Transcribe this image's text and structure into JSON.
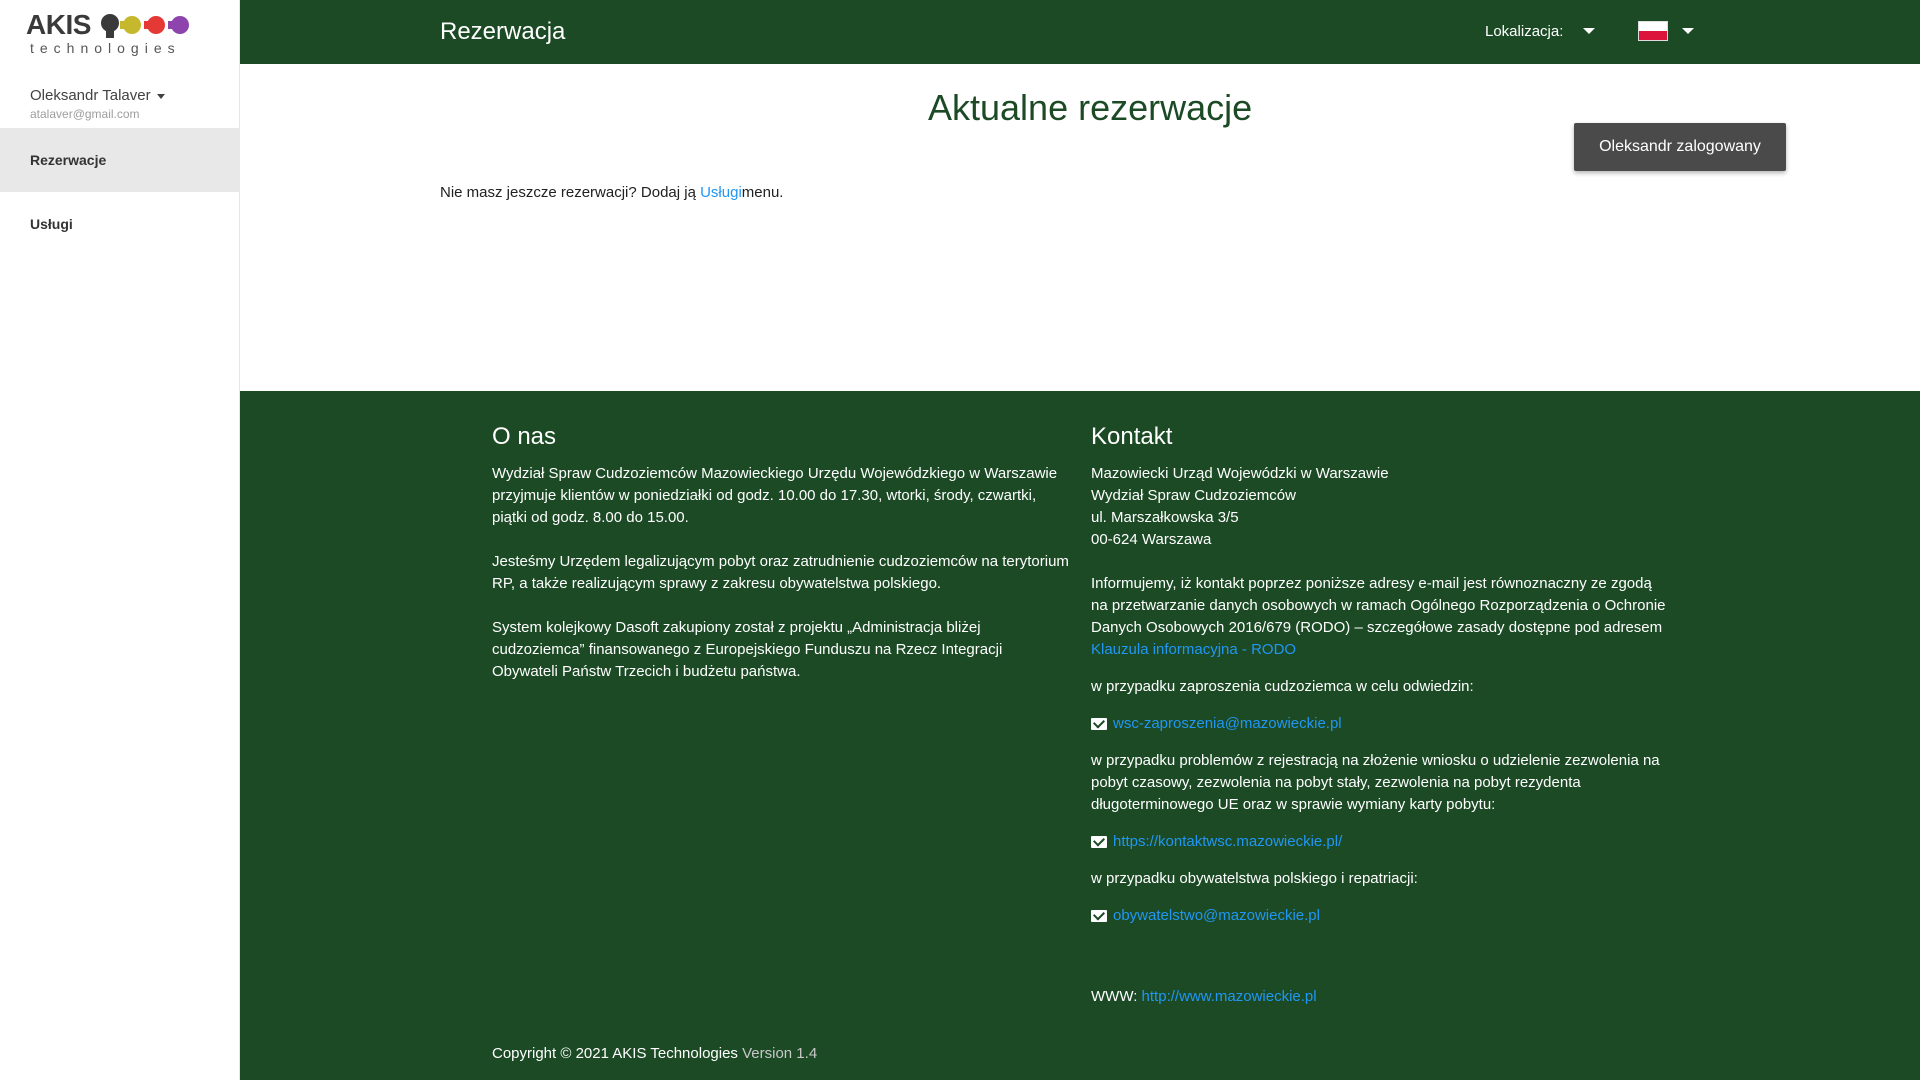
{
  "logo": {
    "word": "AKIS",
    "subtitle": "technologies",
    "colors": [
      "#e53935",
      "#fbc02d",
      "#8e24aa",
      "#6b8e23"
    ]
  },
  "user": {
    "name": "Oleksandr Talaver",
    "email": "atalaver@gmail.com"
  },
  "sidebar": {
    "items": [
      {
        "label": "Rezerwacje",
        "active": true
      },
      {
        "label": "Usługi",
        "active": false
      }
    ]
  },
  "topbar": {
    "title": "Rezerwacja",
    "location_label": "Lokalizacja:",
    "language_flag": "pl-flag-icon",
    "bg_color": "#1b4a25"
  },
  "main": {
    "title": "Aktualne rezerwacje",
    "login_badge": "Oleksandr zalogowany",
    "empty_prefix": "Nie masz jeszcze rezerwacji? Dodaj ją ",
    "empty_link": "Usługi",
    "empty_suffix": "menu."
  },
  "footer": {
    "about": {
      "heading": "O nas",
      "p1": "Wydział Spraw Cudzoziemców Mazowieckiego Urzędu Wojewódzkiego w Warszawie przyjmuje klientów w poniedziałki od godz. 10.00 do 17.30, wtorki, środy, czwartki, piątki od godz. 8.00 do 15.00.",
      "p2": "Jesteśmy Urzędem legalizującym pobyt oraz zatrudnienie cudzoziemców na terytorium RP, a także realizującym sprawy z zakresu obywatelstwa polskiego.",
      "p3": "System kolejkowy Dasoft zakupiony został z projektu „Administracja bliżej cudzoziemca” finansowanego z Europejskiego Funduszu na Rzecz Integracji Obywateli Państw Trzecich i budżetu państwa."
    },
    "contact": {
      "heading": "Kontakt",
      "addr1": "Mazowiecki Urząd Wojewódzki w Warszawie",
      "addr2": "Wydział Spraw Cudzoziemców",
      "addr3": "ul. Marszałkowska 3/5",
      "addr4": "00-624 Warszawa",
      "info": "Informujemy, iż kontakt poprzez poniższe adresy e-mail jest równoznaczny ze zgodą na przetwarzanie danych osobowych w ramach Ogólnego Rozporządzenia o Ochronie Danych Osobowych 2016/679 (RODO) – szczegółowe zasady dostępne pod adresem",
      "rodo_link": "Klauzula informacyjna - RODO",
      "invite_label": "w przypadku zaproszenia cudzoziemca w celu odwiedzin:",
      "invite_email": "wsc-zaproszenia@mazowieckie.pl",
      "problems_label": "w przypadku problemów z rejestracją na złożenie wniosku o udzielenie zezwolenia na pobyt czasowy, zezwolenia na pobyt stały, zezwolenia na pobyt rezydenta długoterminowego UE oraz w sprawie wymiany karty pobytu:",
      "problems_link": "https://kontaktwsc.mazowieckie.pl/",
      "citizenship_label": "w przypadku obywatelstwa polskiego i repatriacji:",
      "citizenship_email": "obywatelstwo@mazowieckie.pl",
      "www_label": "WWW:",
      "www_link": "http://www.mazowieckie.pl"
    },
    "copyright": "Copyright © 2021 AKIS Technologies",
    "version": "Version 1.4"
  }
}
